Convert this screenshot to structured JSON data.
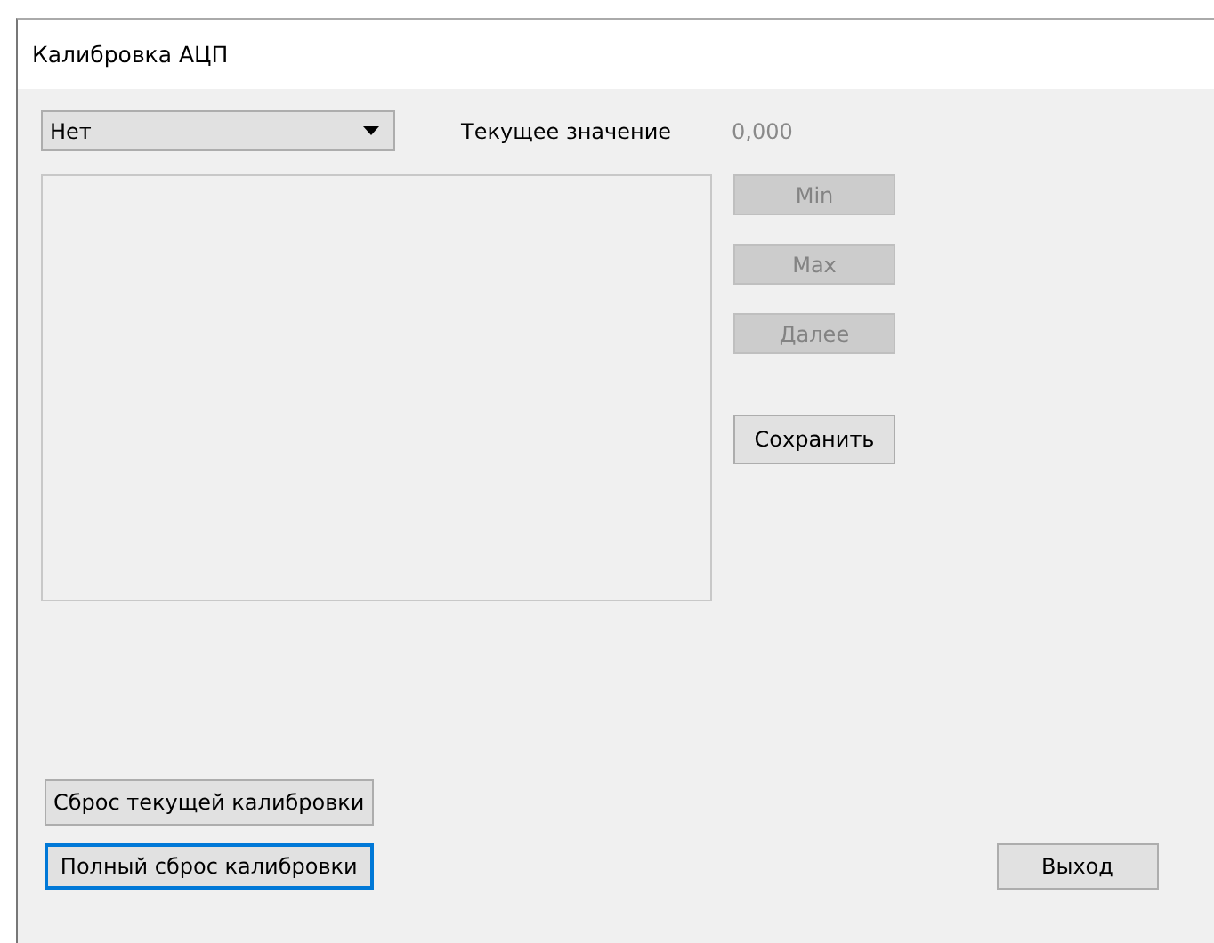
{
  "window": {
    "title": "Калибровка АЦП"
  },
  "channel_select": {
    "value": "Нет"
  },
  "current_value": {
    "label": "Текущее значение",
    "value": "0,000"
  },
  "side_buttons": [
    {
      "label": "Min",
      "disabled": true
    },
    {
      "label": "Max",
      "disabled": true
    },
    {
      "label": "Далее",
      "disabled": true
    },
    {
      "label": "Сохранить",
      "disabled": false
    }
  ],
  "reset_buttons": [
    {
      "label": "Сброс текущей калибровки",
      "focused": false
    },
    {
      "label": "Полный сброс калибровки",
      "focused": true
    }
  ],
  "exit_button": {
    "label": "Выход",
    "focused": false
  }
}
